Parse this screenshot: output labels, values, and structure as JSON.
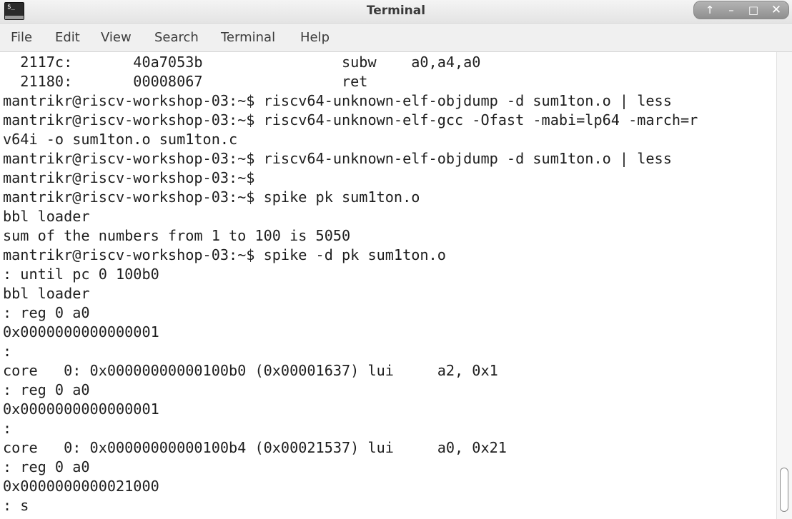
{
  "window": {
    "title": "Terminal",
    "app_icon_text": "$_",
    "controls": {
      "up": "↑",
      "minimize": "–",
      "maximize": "□",
      "close": "✕"
    }
  },
  "menu": {
    "items": [
      "File",
      "Edit",
      "View",
      "Search",
      "Terminal",
      "Help"
    ]
  },
  "terminal": {
    "lines": [
      "  2117c:       40a7053b                subw    a0,a4,a0",
      "  21180:       00008067                ret",
      "mantrikr@riscv-workshop-03:~$ riscv64-unknown-elf-objdump -d sum1ton.o | less",
      "mantrikr@riscv-workshop-03:~$ riscv64-unknown-elf-gcc -Ofast -mabi=lp64 -march=r",
      "v64i -o sum1ton.o sum1ton.c",
      "mantrikr@riscv-workshop-03:~$ riscv64-unknown-elf-objdump -d sum1ton.o | less",
      "mantrikr@riscv-workshop-03:~$",
      "mantrikr@riscv-workshop-03:~$ spike pk sum1ton.o",
      "bbl loader",
      "sum of the numbers from 1 to 100 is 5050",
      "mantrikr@riscv-workshop-03:~$ spike -d pk sum1ton.o",
      ": until pc 0 100b0",
      "bbl loader",
      ": reg 0 a0",
      "0x0000000000000001",
      ":",
      "core   0: 0x00000000000100b0 (0x00001637) lui     a2, 0x1",
      ": reg 0 a0",
      "0x0000000000000001",
      ":",
      "core   0: 0x00000000000100b4 (0x00021537) lui     a0, 0x21",
      ": reg 0 a0",
      "0x0000000000021000",
      ": s"
    ]
  },
  "colors": {
    "terminal_bg": "#ffffff",
    "terminal_fg": "#1e1e1e",
    "titlebar_bg": "#ececec",
    "menubar_bg": "#f0f0f0",
    "window_controls_bg": "#a0a0a0"
  },
  "scrollbar": {
    "position_fraction": 1.0
  }
}
